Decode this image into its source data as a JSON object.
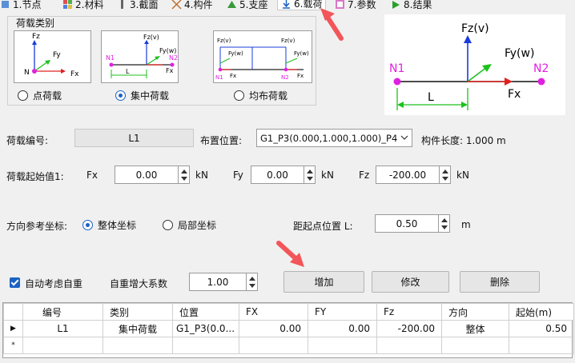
{
  "tabs": [
    {
      "label": "1.节点",
      "icon": "node-icon"
    },
    {
      "label": "2.材料",
      "icon": "material-icon"
    },
    {
      "label": "3.截面",
      "icon": "section-icon"
    },
    {
      "label": "4.构件",
      "icon": "member-icon"
    },
    {
      "label": "5.支座",
      "icon": "support-icon"
    },
    {
      "label": "6.载荷",
      "icon": "load-icon",
      "active": true
    },
    {
      "label": "7.参数",
      "icon": "param-icon"
    },
    {
      "label": "8.结果",
      "icon": "result-icon"
    }
  ],
  "load_type": {
    "title": "荷载类别",
    "options": [
      {
        "label": "点荷载",
        "selected": false
      },
      {
        "label": "集中荷载",
        "selected": true
      },
      {
        "label": "均布荷载",
        "selected": false
      }
    ],
    "thumb1": {
      "fz": "Fz",
      "fy": "Fy",
      "fx": "Fx",
      "n": "N"
    },
    "thumb2": {
      "fzv": "Fz(v)",
      "fyw": "Fy(w)",
      "fx": "Fx",
      "n1": "N1",
      "n2": "N2",
      "l": "L"
    },
    "thumb3": {
      "fzv_left": "Fz(v)",
      "fyw_left": "Fy(w)",
      "fzv_right": "Fz(v)",
      "fyw_right": "Fy(w)",
      "n1": "N1",
      "fx_left": "Fx",
      "n2": "N2",
      "fx_right": "Fx"
    }
  },
  "diagram": {
    "fzv": "Fz(v)",
    "fyw": "Fy(w)",
    "fx": "Fx",
    "n1": "N1",
    "n2": "N2",
    "l": "L"
  },
  "form": {
    "load_id_label": "荷载编号:",
    "load_id_value": "L1",
    "location_label": "布置位置:",
    "location_value": "G1_P3(0.000,1.000,1.000)_P4",
    "member_length": "构件长度: 1.000 m",
    "start_value_label": "荷载起始值1:",
    "fx_label": "Fx",
    "fx_value": "0.00",
    "fx_unit": "kN",
    "fy_label": "Fy",
    "fy_value": "0.00",
    "fy_unit": "kN",
    "fz_label": "Fz",
    "fz_value": "-200.00",
    "fz_unit": "kN",
    "direction_label": "方向参考坐标:",
    "global_coord": "整体坐标",
    "local_coord": "局部坐标",
    "distance_label": "距起点位置 L:",
    "distance_value": "0.50",
    "distance_unit": "m",
    "self_weight_label": "自动考虑自重",
    "amplify_label": "自重增大系数",
    "amplify_value": "1.00"
  },
  "buttons": {
    "add": "增加",
    "modify": "修改",
    "delete": "删除"
  },
  "table": {
    "headers": [
      "编号",
      "类别",
      "位置",
      "FX",
      "FY",
      "Fz",
      "方向",
      "起始(m)"
    ],
    "rows": [
      [
        "L1",
        "集中荷载",
        "G1_P3(0.0...",
        "0.00",
        "0.00",
        "-200.00",
        "整体",
        "0.50"
      ]
    ],
    "current_marker": "▶",
    "new_marker": "*"
  },
  "colors": {
    "accent": "#1b62c4",
    "annotation": "#f2555a",
    "node": "#e020e0",
    "green": "#1cc21c",
    "blue": "#1a3cd8",
    "red": "#e02020"
  }
}
